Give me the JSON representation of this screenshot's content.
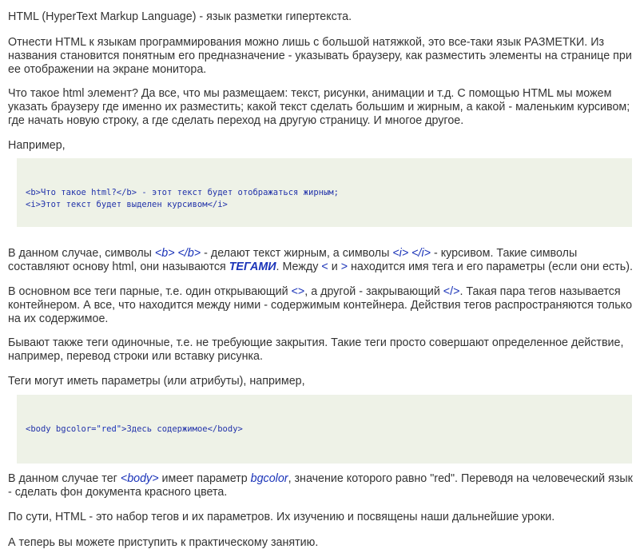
{
  "p1": "HTML (HyperText Markup Language) - язык разметки гипертекста.",
  "p2": "Отнести HTML к языкам программирования можно лишь с большой натяжкой, это все-таки язык РАЗМЕТКИ. Из названия становится понятным его предназначение - указывать браузеру, как разместить элементы на странице при ее отображении на экране монитора.",
  "p3": "Что такое html элемент? Да все, что мы размещаем: текст, рисунки, анимации и т.д. С помощью HTML мы можем указать браузеру где именно их разместить; какой текст сделать большим и жирным, а какой - маленьким курсивом; где начать новую строку, а где сделать переход на другую страницу. И многое другое.",
  "p4": "Например,",
  "code1": {
    "line1": "<b>Что такое html?</b> - этот текст будет отображаться жирным;",
    "line2": "<i>Этот текст будет выделен курсивом</i>"
  },
  "p5": {
    "t1": "В данном случае, символы ",
    "c1": "<b> </b>",
    "t2": " - делают текст жирным, а символы ",
    "c2": "<i> </i>",
    "t3": " - курсивом. Такие символы составляют основу html, они называются ",
    "term": "ТЕГАМИ",
    "t4": ". Между ",
    "lt": "<",
    "t5": " и ",
    "gt": ">",
    "t6": " находится имя тега и его параметры (если они есть)."
  },
  "p6": {
    "t1": "В основном все теги парные, т.е. один открывающий ",
    "c1": "<>",
    "t2": ", а другой - закрывающий ",
    "c2": "</>",
    "t3": ". Такая пара тегов называется контейнером. А все, что находится между ними - содержимым контейнера. Действия тегов распространяются только на их содержимое."
  },
  "p7": "Бывают также теги одиночные, т.е. не требующие закрытия. Такие теги просто совершают определенное действие, например, перевод строки или вставку рисунка.",
  "p8": "Теги могут иметь параметры (или атрибуты), например,",
  "code2": {
    "a": "<body bgcolor=",
    "b": "\"red\"",
    "c": ">Здесь содержимое</body>"
  },
  "p9": {
    "t1": "В данном случае тег ",
    "c1": "<body>",
    "t2": " имеет параметр ",
    "c2": "bgcolor",
    "t3": ", значение которого равно \"red\". Переводя на человеческий язык - сделать фон документа красного цвета."
  },
  "p10": "По сути, HTML - это набор тегов и их параметров. Их изучению и посвящены наши дальнейшие уроки.",
  "p11": "А теперь вы можете приступить к практическому занятию."
}
